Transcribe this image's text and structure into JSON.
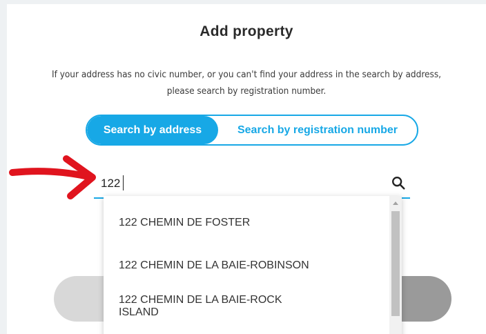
{
  "dialog": {
    "title": "Add property",
    "description_line1": "If your address has no civic number, or you can't find your address in the search by address,",
    "description_line2": "please search by registration number."
  },
  "toggle": {
    "address_label": "Search by address",
    "registration_label": "Search by registration number",
    "active": "address"
  },
  "search": {
    "value": "122",
    "icon": "search-icon"
  },
  "dropdown": {
    "items": [
      {
        "line1": "122 CHEMIN DE FOSTER",
        "line2": ""
      },
      {
        "line1": "122 CHEMIN DE LA BAIE-ROBINSON",
        "line2": ""
      },
      {
        "line1": "122 CHEMIN DE LA BAIE-ROCK",
        "line2": "ISLAND"
      }
    ]
  },
  "colors": {
    "accent": "#17a8e6",
    "annotation_arrow": "#e0141e"
  }
}
